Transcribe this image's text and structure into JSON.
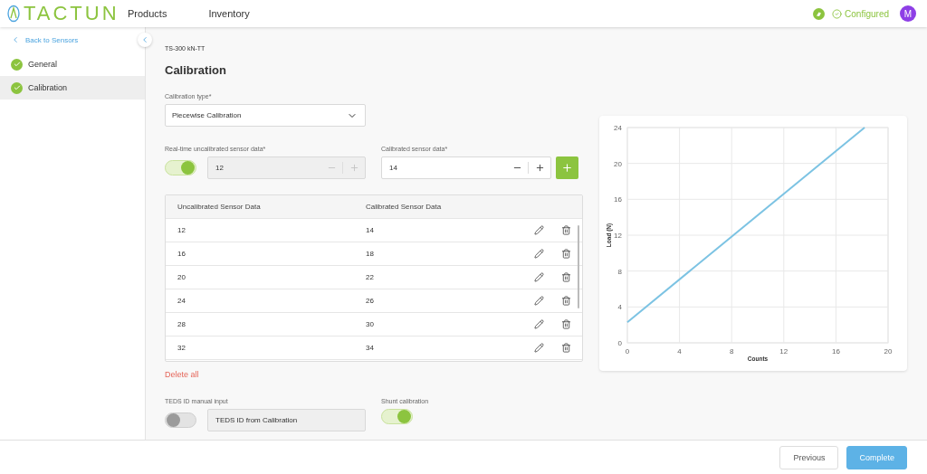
{
  "header": {
    "logo": "TACTUN",
    "nav": [
      {
        "label": "Products"
      },
      {
        "label": "Inventory"
      }
    ],
    "status": "Configured",
    "avatar": "M"
  },
  "sidebar": {
    "back": "Back to Sensors",
    "steps": [
      {
        "label": "General",
        "selected": false
      },
      {
        "label": "Calibration",
        "selected": true
      }
    ]
  },
  "page": {
    "breadcrumb": "TS-300 kN-TT",
    "title": "Calibration"
  },
  "calibration_type": {
    "label": "Calibration type*",
    "value": "Piecewise Calibration"
  },
  "realtime": {
    "label": "Real-time uncalibrated sensor data*",
    "on": true,
    "value": "12"
  },
  "calibrated": {
    "label": "Calibrated sensor data*",
    "value": "14"
  },
  "table": {
    "columns": [
      "Uncalibrated Sensor Data",
      "Calibrated Sensor Data"
    ],
    "rows": [
      [
        "12",
        "14"
      ],
      [
        "16",
        "18"
      ],
      [
        "20",
        "22"
      ],
      [
        "24",
        "26"
      ],
      [
        "28",
        "30"
      ],
      [
        "32",
        "34"
      ]
    ]
  },
  "delete_all": "Delete all",
  "teds": {
    "label": "TEDS ID manual input",
    "on": false,
    "value": "TEDS ID from Calibration"
  },
  "shunt": {
    "label": "Shunt calibration",
    "on": true
  },
  "chart_data": {
    "type": "line",
    "grid": true,
    "xlabel": "Counts",
    "ylabel": "Load (N)",
    "x": [
      0,
      18.2
    ],
    "series": [
      {
        "color": "#7cc3e3",
        "values": [
          2.3,
          24
        ]
      }
    ],
    "xlim": [
      0,
      20
    ],
    "ylim": [
      0,
      24
    ],
    "xticks": [
      0,
      4,
      8,
      12,
      16,
      20
    ],
    "yticks": [
      0,
      4,
      8,
      12,
      16,
      20,
      24
    ]
  },
  "footer": {
    "buttons": [
      {
        "label": "Previous",
        "kind": "secondary"
      },
      {
        "label": "Complete",
        "kind": "primary"
      }
    ]
  }
}
